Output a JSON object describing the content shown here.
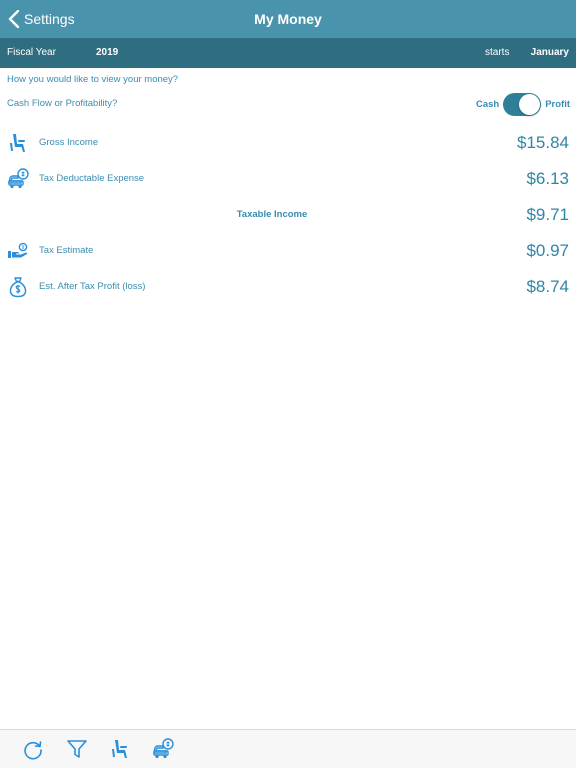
{
  "navbar": {
    "back_label": "Settings",
    "title": "My Money"
  },
  "fiscal": {
    "label": "Fiscal Year",
    "year": "2019",
    "starts_label": "starts",
    "starts_month": "January"
  },
  "view": {
    "prompt": "How you would like to view your money?",
    "question": "Cash Flow or Profitability?",
    "toggle_left": "Cash",
    "toggle_right": "Profit",
    "toggle_on": true
  },
  "rows": [
    {
      "label": "Gross Income",
      "value": "$15.84",
      "icon": "chair-icon"
    },
    {
      "label": "Tax Deductable Expense",
      "value": "$6.13",
      "icon": "car-expense-icon"
    },
    {
      "label": "Taxable Income",
      "value": "$9.71",
      "icon": ""
    },
    {
      "label": "Tax Estimate",
      "value": "$0.97",
      "icon": "hand-coins-icon"
    },
    {
      "label": "Est. After Tax Profit (loss)",
      "value": "$8.74",
      "icon": "money-bag-icon"
    }
  ],
  "tabbar": {
    "icons": [
      "refresh-icon",
      "filter-icon",
      "chair-icon",
      "car-expense-icon"
    ]
  },
  "colors": {
    "navbar": "#4a93ad",
    "fiscal_bar": "#2f6d80",
    "accent_text": "#3a8db0",
    "value_text": "#2f86a6",
    "icon_blue": "#2a8fd8"
  }
}
